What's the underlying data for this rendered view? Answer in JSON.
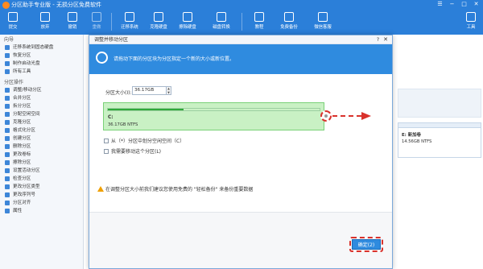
{
  "app": {
    "title": "分区助手专业版 - 无损分区免费软件",
    "window_controls": [
      "☰",
      "−",
      "□",
      "✕"
    ]
  },
  "toolbar": {
    "items": [
      {
        "key": "commit",
        "label": "提交",
        "enabled": true
      },
      {
        "key": "discard",
        "label": "放弃",
        "enabled": true
      },
      {
        "key": "undo",
        "label": "撤销",
        "enabled": true
      },
      {
        "key": "redo",
        "label": "重做",
        "enabled": false
      },
      {
        "key": "migrate",
        "label": "迁移系统",
        "enabled": true
      },
      {
        "key": "clone",
        "label": "克隆硬盘",
        "enabled": true
      },
      {
        "key": "wipe",
        "label": "擦除硬盘",
        "enabled": true
      },
      {
        "key": "convert",
        "label": "磁盘转换",
        "enabled": true
      },
      {
        "key": "tutorial",
        "label": "教程",
        "enabled": true
      },
      {
        "key": "backup",
        "label": "免费备份",
        "enabled": true
      },
      {
        "key": "wechat",
        "label": "微信客服",
        "enabled": true
      },
      {
        "key": "tools",
        "label": "工具",
        "enabled": true
      }
    ]
  },
  "sidebar": {
    "wizard_header": "向导",
    "wizard_items": [
      "迁移系统到固态硬盘",
      "恢复分区",
      "制作启动光盘",
      "所有工具"
    ],
    "ops_header": "分区操作",
    "ops_items": [
      "调整/移动分区",
      "合并分区",
      "拆分分区",
      "分配空闲空间",
      "克隆分区",
      "格式化分区",
      "创建分区",
      "删除分区",
      "更改卷标",
      "擦除分区",
      "设置活动分区",
      "检查分区",
      "更改分区类型",
      "更改序列号",
      "分区对齐",
      "属性"
    ]
  },
  "background_partition": {
    "name": "E: 新加卷",
    "info": "14.56GB NTFS"
  },
  "dialog": {
    "title": "调整并移动分区",
    "help": "?",
    "close": "✕",
    "banner_text": "请拖动下面的分区块为分区指定一个新的大小或新位置。",
    "size_label": "分区大小(I):",
    "size_value": "36.17GB",
    "partition_name": "C:",
    "partition_info": "36.17GB NTFS",
    "used_fraction": 0.36,
    "option1": "从（*）分区中划分空闲空间（C）",
    "option2": "我需要移动这个分区(L)",
    "warning": "在调整分区大小前我们建议您使用免费的 \"轻松备份\" 来备份重要数据",
    "ok_label": "确定(2)"
  }
}
